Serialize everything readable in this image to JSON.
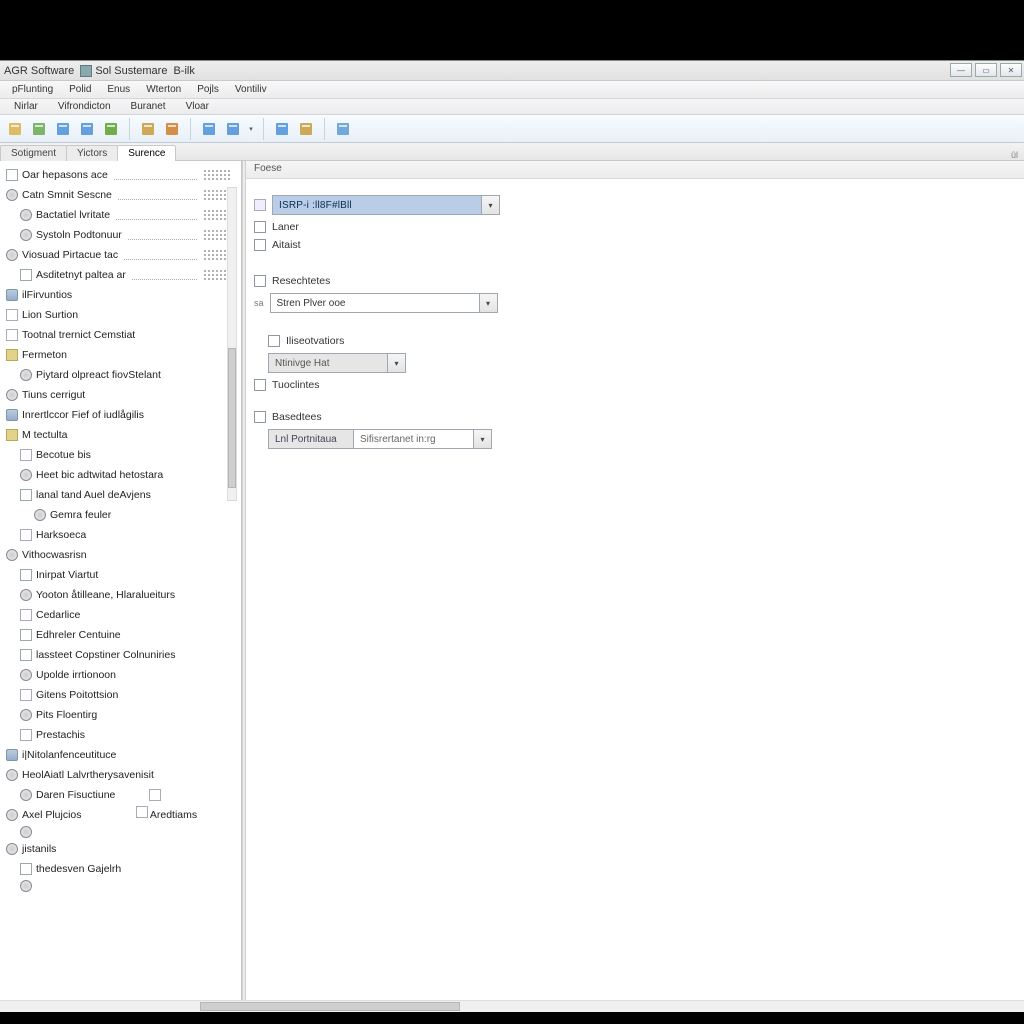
{
  "title": {
    "seg1": "AGR Software",
    "seg2": "Sol Sustemare",
    "seg3": "B-ilk"
  },
  "menu": {
    "items": [
      "pFlunting",
      "Polid",
      "Enus",
      "Wterton",
      "Pojls",
      "Vontiliv"
    ]
  },
  "menu2": {
    "items": [
      "Nirlar",
      "Vifrondicton",
      "Buranet",
      "Vloar"
    ]
  },
  "tabs": {
    "left": [
      "Sotigment",
      "Yictors"
    ],
    "active": "Surence",
    "right_pin": "ûl"
  },
  "main_tab": "Foese",
  "tree": [
    {
      "lvl": 0,
      "icon": "i-doc",
      "label": "Oar hepasons ace",
      "dots": true,
      "pattern": true
    },
    {
      "lvl": 0,
      "icon": "i-gear",
      "label": "Catn Smnit Sescne",
      "dots": true,
      "pattern": true
    },
    {
      "lvl": 1,
      "icon": "i-gear",
      "label": "Bactatiel lvritate",
      "dots": true,
      "pattern": true
    },
    {
      "lvl": 1,
      "icon": "i-gear",
      "label": "Systoln Podtonuur",
      "dots": true,
      "pattern": true
    },
    {
      "lvl": 0,
      "icon": "i-gear",
      "label": "Viosuad Pirtacue tac",
      "dots": true,
      "pattern": true
    },
    {
      "lvl": 1,
      "icon": "i-doc",
      "label": "Asditetnyt paltea ar",
      "dots": true,
      "pattern": true
    },
    {
      "lvl": 0,
      "icon": "i-db",
      "label": "ilFirvuntios"
    },
    {
      "lvl": 0,
      "icon": "i-page",
      "label": "Lion Surtion"
    },
    {
      "lvl": 0,
      "icon": "i-page",
      "label": "Tootnal trernict Cemstiat"
    },
    {
      "lvl": 0,
      "icon": "i-folder",
      "label": "Fermeton"
    },
    {
      "lvl": 1,
      "icon": "i-gear",
      "label": "Piytard olpreact fiovStelant"
    },
    {
      "lvl": 0,
      "icon": "i-gear",
      "label": "Tiuns cerrigut"
    },
    {
      "lvl": 0,
      "icon": "i-db",
      "label": "Inrertlccor Fief of iudlågilis"
    },
    {
      "lvl": 0,
      "icon": "i-folder",
      "label": "M tectulta"
    },
    {
      "lvl": 1,
      "icon": "i-page",
      "label": "Becotue bis"
    },
    {
      "lvl": 1,
      "icon": "i-gear",
      "label": "Heet bic adtwitad hetostara"
    },
    {
      "lvl": 1,
      "icon": "i-doc",
      "label": "lanal tand Auel deAvjens"
    },
    {
      "lvl": 2,
      "icon": "i-gear",
      "label": "Gemra feuler"
    },
    {
      "lvl": 1,
      "icon": "i-page",
      "label": "Harksoeca"
    },
    {
      "lvl": 0,
      "icon": "i-gear",
      "label": "Vithocwasrisn"
    },
    {
      "lvl": 1,
      "icon": "i-doc",
      "label": "Inirpat Viartut"
    },
    {
      "lvl": 1,
      "icon": "i-gear",
      "label": "Yooton åtilleane, Hlaralueiturs"
    },
    {
      "lvl": 1,
      "icon": "i-page",
      "label": "Cedarlice"
    },
    {
      "lvl": 1,
      "icon": "i-doc",
      "label": "Edhreler Centuine"
    },
    {
      "lvl": 1,
      "icon": "i-doc",
      "label": "lassteet Copstiner Colnuniries"
    },
    {
      "lvl": 1,
      "icon": "i-gear",
      "label": "Upolde irrtionoon"
    },
    {
      "lvl": 1,
      "icon": "i-page",
      "label": "Gitens Poitottsion"
    },
    {
      "lvl": 1,
      "icon": "i-gear",
      "label": "Pits Floentirg"
    },
    {
      "lvl": 1,
      "icon": "i-page",
      "label": "Prestachis"
    },
    {
      "lvl": 0,
      "icon": "i-db",
      "label": "i|Nitolanfenceutituce"
    },
    {
      "lvl": 0,
      "icon": "i-gear",
      "label": "HeolAiatl Lalvrtherysavenisit"
    },
    {
      "lvl": 1,
      "icon": "i-gear",
      "label": "Daren Fisuctiune",
      "extra_icon": true
    },
    {
      "lvl": 0,
      "icon": "i-gear",
      "label": "Axel Plujcios",
      "extra_label": "Aredtiams"
    },
    {
      "lvl": 1,
      "icon": "i-gear",
      "label": ""
    },
    {
      "lvl": 0,
      "icon": "i-gear",
      "label": "jistanils"
    },
    {
      "lvl": 1,
      "icon": "i-doc",
      "label": "thedesven Gajelrh"
    },
    {
      "lvl": 1,
      "icon": "i-gear",
      "label": ""
    }
  ],
  "form": {
    "combo1": "ISRP-i  :ll8F#lBll",
    "chk_laser": "Laner",
    "chk_aitaist": "Aitaist",
    "chk_resechetes": "Resechtetes",
    "combo2_prefix": "sa",
    "combo2": "Stren Plver ooe",
    "chk_iliseotvatiors": "Iliseotvatiors",
    "combo3": "Ntinivge Hat",
    "chk_tuoclintes": "Tuoclintes",
    "chk_basedtees": "Basedtees",
    "combo4a": "Lnl Portnitaua",
    "combo4b": "Sifisrertanet in:rg"
  },
  "toolbar_icons": [
    "doc-icon",
    "puzzle-icon",
    "refresh-icon",
    "save-icon",
    "table-green-icon",
    "sep",
    "sheet-icon",
    "grid-icon",
    "sep",
    "book-icon",
    "page-blue-icon",
    "dropdown",
    "sep",
    "window-icon",
    "export-icon",
    "sep",
    "cloud-icon"
  ]
}
